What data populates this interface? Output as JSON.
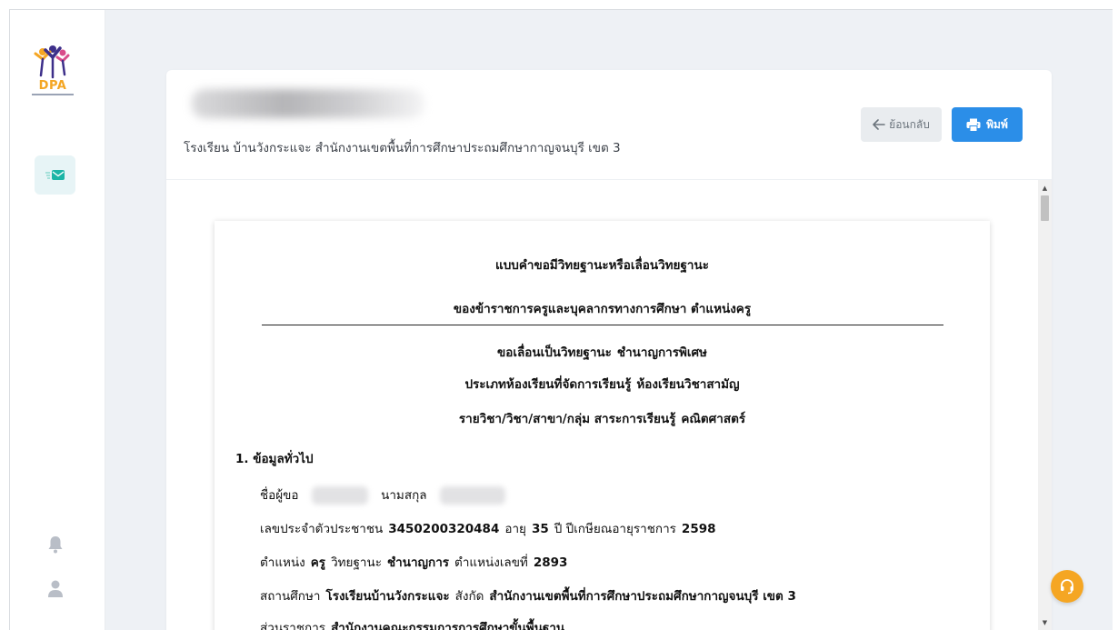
{
  "sidebar": {
    "logo_text": "DPA",
    "items": [
      {
        "name": "mail",
        "icon": "mail-icon",
        "active": true
      },
      {
        "name": "notifications",
        "icon": "bell-icon"
      },
      {
        "name": "profile",
        "icon": "user-icon"
      }
    ]
  },
  "header": {
    "subtitle": "โรงเรียน บ้านวังกระแจะ สำนักงานเขตพื้นที่การศึกษาประถมศึกษากาญจนบุรี เขต 3",
    "back_label": "ย้อนกลับ",
    "print_label": "พิมพ์"
  },
  "document": {
    "title_1": "แบบคำขอมีวิทยฐานะหรือเลื่อนวิทยฐานะ",
    "title_2": "ของข้าราชการครูและบุคลากรทางการศึกษา ตำแหน่งครู",
    "request_label": "ขอเลื่อนเป็นวิทยฐานะ",
    "request_value": "ชำนาญการพิเศษ",
    "classroom_label": "ประเภทห้องเรียนที่จัดการเรียนรู้",
    "classroom_value": "ห้องเรียนวิชาสามัญ",
    "subject_label": "รายวิชา/วิชา/สาขา/กลุ่ม สาระการเรียนรู้",
    "subject_value": "คณิตศาสตร์",
    "section_1": "1. ข้อมูลทั่วไป",
    "name_label": "ชื่อผู้ขอ",
    "surname_label": "นามสกุล",
    "id_label": "เลขประจำตัวประชาชน",
    "id_value": "3450200320484",
    "age_label": "อายุ",
    "age_value": "35",
    "retire_label": "ปี ปีเกษียณอายุราชการ",
    "retire_value": "2598",
    "position_label": "ตำแหน่ง",
    "position_value": "ครู",
    "rank_label": "วิทยฐานะ",
    "rank_value": "ชำนาญการ",
    "posno_label": "ตำแหน่งเลขที่",
    "posno_value": "2893",
    "school_label": "สถานศึกษา",
    "school_value": "โรงเรียนบ้านวังกระแจะ",
    "under_label": "สังกัด",
    "under_value": "สำนักงานเขตพื้นที่การศึกษาประถมศึกษากาญจนบุรี เขต 3",
    "agency_label": "ส่วนราชการ",
    "agency_value": "สำนักงานคณะกรรมการการศึกษาขั้นพื้นฐาน"
  },
  "colors": {
    "accent": "#2b8ee8",
    "help": "#f5a623",
    "background": "#eef1f5"
  }
}
